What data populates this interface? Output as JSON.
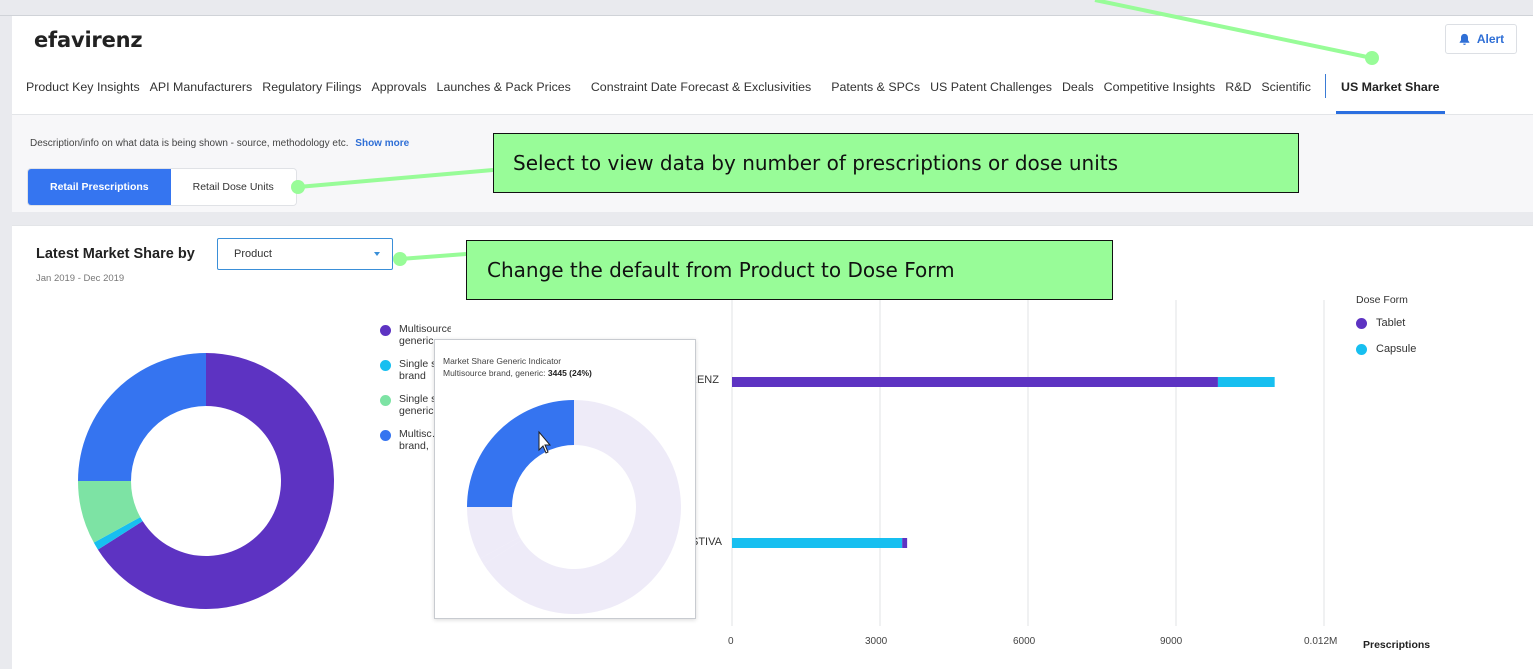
{
  "app": {
    "title": "efavirenz",
    "alert_label": "Alert"
  },
  "tabs": [
    {
      "label": "Product Key Insights"
    },
    {
      "label": "API Manufacturers"
    },
    {
      "label": "Regulatory Filings"
    },
    {
      "label": "Approvals"
    },
    {
      "label": "Launches & Pack Prices"
    },
    {
      "label": "Constraint Date Forecast & Exclusivities"
    },
    {
      "label": "Patents & SPCs"
    },
    {
      "label": "US Patent Challenges"
    },
    {
      "label": "Deals"
    },
    {
      "label": "Competitive Insights"
    },
    {
      "label": "R&D"
    },
    {
      "label": "Scientific"
    },
    {
      "label": "US Market Share",
      "active": true
    }
  ],
  "description": {
    "text": "Description/info on what data is being shown - source, methodology etc.",
    "show_more": "Show more"
  },
  "segment": {
    "option1": "Retail Prescriptions",
    "option2": "Retail Dose Units",
    "selected": "Retail Prescriptions"
  },
  "card": {
    "title": "Latest Market Share by",
    "date_range": "Jan 2019 - Dec 2019",
    "select_value": "Product"
  },
  "left_legend": [
    {
      "label": "Multisource generic",
      "color": "#5d33c2"
    },
    {
      "label": "Single s… brand",
      "color": "#17bff0"
    },
    {
      "label": "Single s… generic",
      "color": "#7de3a4"
    },
    {
      "label": "Multisc… brand,",
      "color": "#3574f0"
    }
  ],
  "tooltip": {
    "title": "Market Share Generic Indicator",
    "series": "Multisource brand, generic:",
    "value": "3445 (24%)"
  },
  "callouts": {
    "c1": "Select to view data by number of prescriptions or dose units",
    "c2": "Change the default from Product to Dose Form"
  },
  "dose_legend": {
    "title": "Dose Form",
    "items": [
      {
        "label": "Tablet",
        "color": "#5d33c2"
      },
      {
        "label": "Capsule",
        "color": "#17bff0"
      }
    ]
  },
  "chart_data": {
    "type": "bar",
    "orientation": "horizontal",
    "stacked": true,
    "categories": [
      "…RENZ",
      "…STIVA"
    ],
    "series": [
      {
        "name": "Tablet",
        "values": [
          9850,
          100
        ],
        "color": "#5d33c2"
      },
      {
        "name": "Capsule",
        "values": [
          1150,
          3450
        ],
        "color": "#17bff0"
      }
    ],
    "x_ticks": [
      "0",
      "3000",
      "6000",
      "9000",
      "0.012M"
    ],
    "xlabel": "Prescriptions",
    "xlim": [
      0,
      12000
    ],
    "grid": true,
    "legend_position": "top-right"
  },
  "donut": {
    "segments": [
      {
        "label": "Multisource generic",
        "value": 66,
        "color": "#5d33c2"
      },
      {
        "label": "Single source brand",
        "value": 1,
        "color": "#17bff0"
      },
      {
        "label": "Single source generic",
        "value": 8,
        "color": "#7de3a4"
      },
      {
        "label": "Multisource brand, generic",
        "value": 25,
        "color": "#3574f0"
      }
    ]
  }
}
